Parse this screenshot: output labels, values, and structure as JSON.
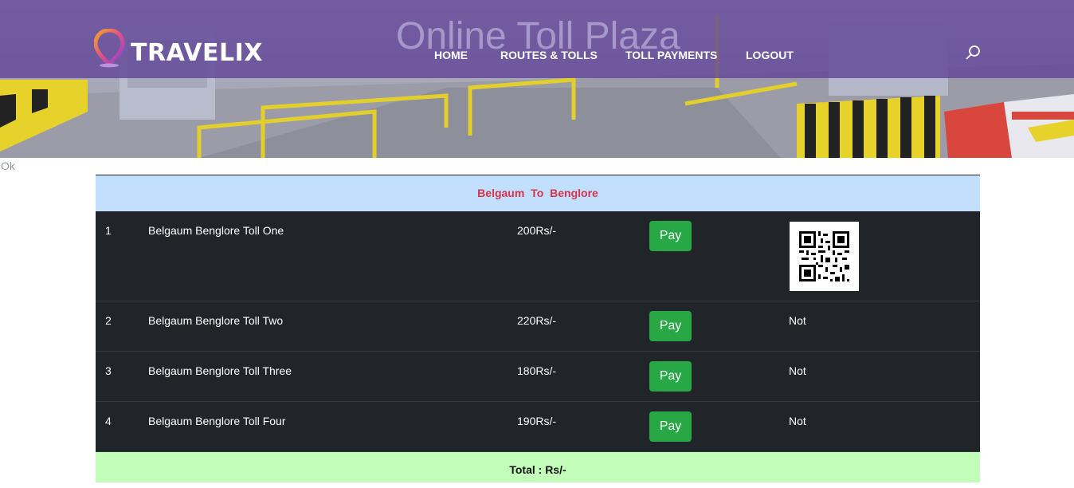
{
  "brand": {
    "name": "TRAVELIX"
  },
  "site_title": "Online Toll Plaza",
  "nav": {
    "home": "HOME",
    "routes": "ROUTES & TOLLS",
    "payments": "TOLL PAYMENTS",
    "logout": "LOGOUT"
  },
  "icons": {
    "search": "search-icon",
    "logo": "location-pin-icon"
  },
  "status_message": "Ok",
  "route": {
    "title": "Belgaum  To  Benglore"
  },
  "tolls": [
    {
      "num": "1",
      "name": "Belgaum Benglore Toll One",
      "amount": "200Rs/-",
      "pay_label": "Pay",
      "status": ""
    },
    {
      "num": "2",
      "name": "Belgaum Benglore Toll Two",
      "amount": "220Rs/-",
      "pay_label": "Pay",
      "status": "Not"
    },
    {
      "num": "3",
      "name": "Belgaum Benglore Toll Three",
      "amount": "180Rs/-",
      "pay_label": "Pay",
      "status": "Not"
    },
    {
      "num": "4",
      "name": "Belgaum Benglore Toll Four",
      "amount": "190Rs/-",
      "pay_label": "Pay",
      "status": "Not"
    }
  ],
  "total": {
    "label": "Total : Rs/-"
  },
  "colors": {
    "navbar": "#604496",
    "route_header_bg": "#c3dffe",
    "route_header_text": "#d6344c",
    "row_bg": "#212529",
    "pay_button": "#28a745",
    "total_bg": "#c2fdba"
  }
}
